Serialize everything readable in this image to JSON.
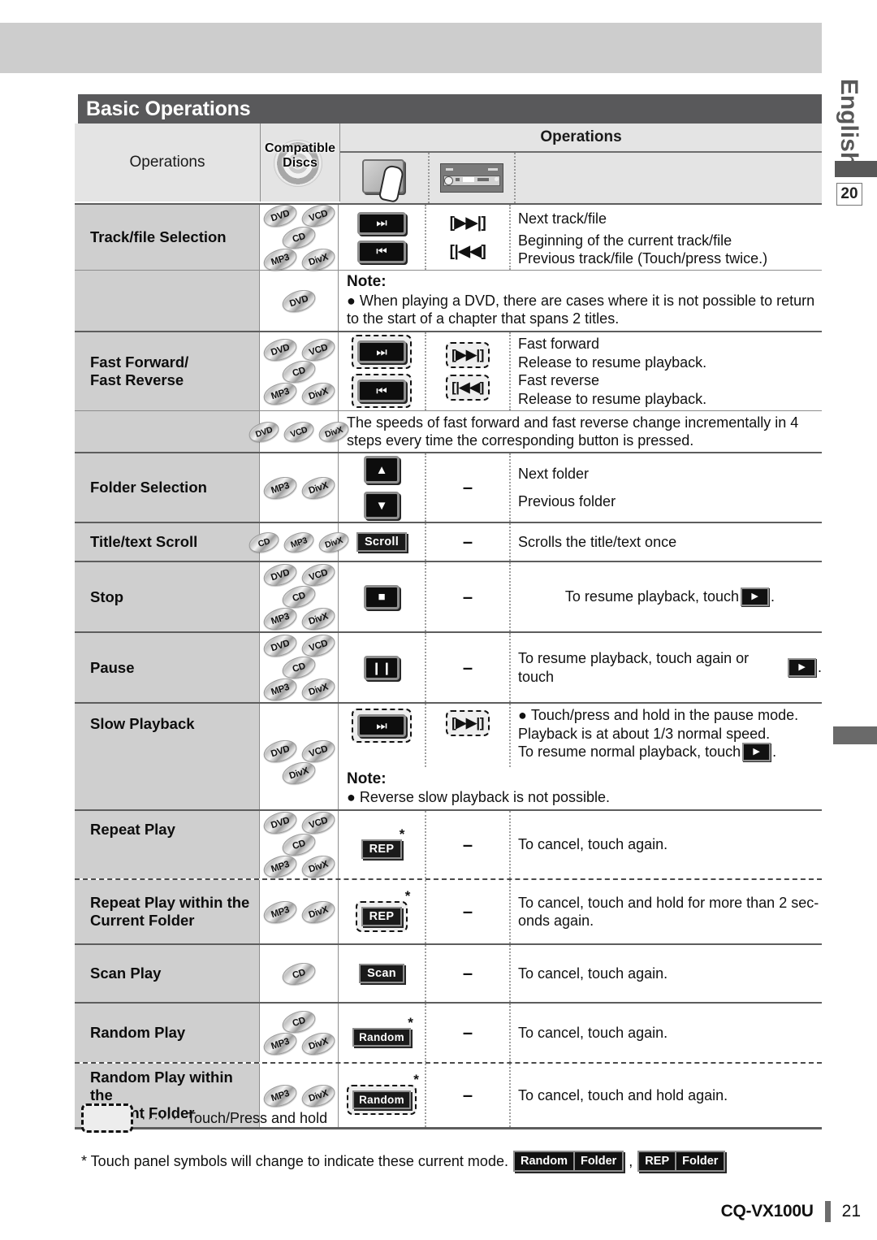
{
  "page": {
    "title": "Basic Operations",
    "language_tab": "English",
    "chapter_number": "20",
    "page_number": "21",
    "model": "CQ-VX100U"
  },
  "table": {
    "header": {
      "operations_col": "Operations",
      "compatible_discs": "Compatible Discs",
      "operations_group": "Operations",
      "touch_icon": "touch-panel-icon",
      "unit_icon": "head-unit-icon"
    },
    "rows": [
      {
        "id": "track-file-selection",
        "label": "Track/file Selection",
        "discs": [
          [
            "DVD",
            "VCD"
          ],
          [
            "CD"
          ],
          [
            "MP3",
            "DivX"
          ]
        ],
        "touch_buttons": [
          "next-track-button",
          "prev-track-button"
        ],
        "unit_keys": [
          "[▶▶|]",
          "[|◀◀]"
        ],
        "descriptions": [
          "Next track/file",
          "Beginning of the current track/file",
          "Previous track/file (Touch/press twice.)"
        ],
        "note": {
          "label": "Note:",
          "text": "When playing a DVD, there are cases where it is not possible to return to the start of a chapter that spans 2 titles.",
          "discs": [
            [
              "DVD"
            ]
          ]
        }
      },
      {
        "id": "fast-forward-fast-reverse",
        "label": "Fast Forward/\nFast Reverse",
        "label_line1": "Fast Forward/",
        "label_line2": "Fast Reverse",
        "discs": [
          [
            "DVD",
            "VCD"
          ],
          [
            "CD"
          ],
          [
            "MP3",
            "DivX"
          ]
        ],
        "descriptions": [
          "Fast forward",
          "Release to resume playback.",
          "Fast reverse",
          "Release to resume playback."
        ],
        "unit_keys": [
          "[▶▶|]",
          "[|◀◀]"
        ],
        "subnote": {
          "discs": [
            [
              "DVD",
              "VCD",
              "DivX"
            ]
          ],
          "text": "The speeds of fast forward and fast reverse change incrementally in 4 steps every time the corresponding button is pressed."
        }
      },
      {
        "id": "folder-selection",
        "label": "Folder Selection",
        "discs": [
          [
            "MP3",
            "DivX"
          ]
        ],
        "unit_keys": [
          "–"
        ],
        "descriptions": [
          "Next folder",
          "Previous folder"
        ]
      },
      {
        "id": "title-text-scroll",
        "label": "Title/text Scroll",
        "discs": [
          [
            "CD",
            "MP3",
            "DivX"
          ]
        ],
        "button_label": "Scroll",
        "unit_keys": [
          "–"
        ],
        "descriptions": [
          "Scrolls the title/text once"
        ]
      },
      {
        "id": "stop",
        "label": "Stop",
        "discs": [
          [
            "DVD",
            "VCD"
          ],
          [
            "CD"
          ],
          [
            "MP3",
            "DivX"
          ]
        ],
        "unit_keys": [
          "–"
        ],
        "description_prefix": "To resume playback, touch",
        "description_suffix": "."
      },
      {
        "id": "pause",
        "label": "Pause",
        "discs": [
          [
            "DVD",
            "VCD"
          ],
          [
            "CD"
          ],
          [
            "MP3",
            "DivX"
          ]
        ],
        "unit_keys": [
          "–"
        ],
        "description_prefix": "To resume playback, touch again or touch",
        "description_suffix": "."
      },
      {
        "id": "slow-playback",
        "label": "Slow Playback",
        "discs": [
          [
            "DVD",
            "VCD"
          ],
          [
            "DivX"
          ]
        ],
        "unit_keys": [
          "[▶▶|]"
        ],
        "descriptions": [
          "Touch/press and hold in the pause mode.",
          "Playback is at about 1/3 normal speed.",
          "To resume normal playback, touch"
        ],
        "description_suffix": ".",
        "note": {
          "label": "Note:",
          "text": "Reverse slow playback is not possible."
        }
      },
      {
        "id": "repeat-play",
        "label": "Repeat Play",
        "discs": [
          [
            "DVD",
            "VCD"
          ],
          [
            "CD"
          ],
          [
            "MP3",
            "DivX"
          ]
        ],
        "button_label": "REP",
        "star": "*",
        "unit_keys": [
          "–"
        ],
        "descriptions": [
          "To cancel, touch again."
        ]
      },
      {
        "id": "repeat-play-within-current-folder",
        "label_line1": "Repeat Play within the",
        "label_line2": "Current Folder",
        "discs": [
          [
            "MP3",
            "DivX"
          ]
        ],
        "button_label": "REP",
        "star": "*",
        "unit_keys": [
          "–"
        ],
        "descriptions": [
          "To cancel, touch and hold for more than 2 sec-",
          "onds again."
        ]
      },
      {
        "id": "scan-play",
        "label": "Scan Play",
        "discs": [
          [
            "CD"
          ]
        ],
        "button_label": "Scan",
        "unit_keys": [
          "–"
        ],
        "descriptions": [
          "To cancel, touch again."
        ]
      },
      {
        "id": "random-play",
        "label": "Random Play",
        "discs": [
          [
            "CD"
          ],
          [
            "MP3",
            "DivX"
          ]
        ],
        "button_label": "Random",
        "star": "*",
        "unit_keys": [
          "–"
        ],
        "descriptions": [
          "To cancel, touch again."
        ]
      },
      {
        "id": "random-play-within-current-folder",
        "label_line1": "Random Play within the",
        "label_line2": "Current Folder",
        "discs": [
          [
            "MP3",
            "DivX"
          ]
        ],
        "button_label": "Random",
        "star": "*",
        "unit_keys": [
          "–"
        ],
        "descriptions": [
          "To cancel, touch and hold again."
        ]
      }
    ]
  },
  "legend": {
    "dots": "······",
    "text": "Touch/Press and hold"
  },
  "footnote": {
    "text": "* Touch panel symbols will change to indicate these current mode.",
    "chip1_a": "Random",
    "chip1_b": "Folder",
    "separator": ",",
    "chip2_a": "REP",
    "chip2_b": "Folder"
  }
}
